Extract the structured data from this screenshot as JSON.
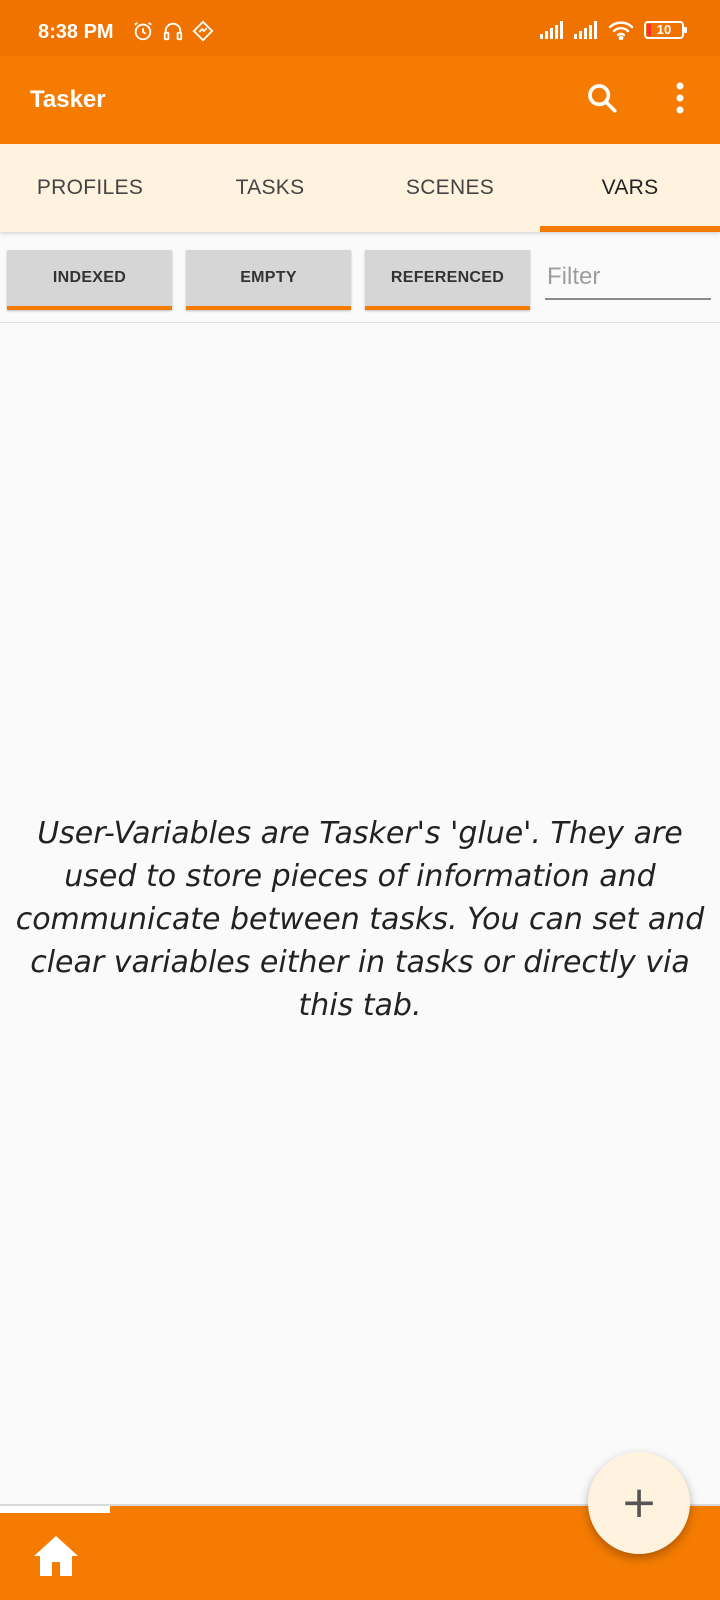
{
  "status_bar": {
    "time": "8:38 PM",
    "battery_level": "10",
    "icons_left": [
      "alarm-icon",
      "headset-icon",
      "sync-icon"
    ],
    "icons_right": [
      "signal-icon",
      "signal-icon",
      "wifi-icon",
      "battery-icon"
    ]
  },
  "app_bar": {
    "title": "Tasker",
    "actions": [
      "search-icon",
      "more-vert-icon"
    ]
  },
  "tabs": [
    {
      "label": "PROFILES",
      "active": false
    },
    {
      "label": "TASKS",
      "active": false
    },
    {
      "label": "SCENES",
      "active": false
    },
    {
      "label": "VARS",
      "active": true
    }
  ],
  "filters": {
    "chips": [
      "INDEXED",
      "EMPTY",
      "REFERENCED"
    ],
    "filter_placeholder": "Filter",
    "filter_value": ""
  },
  "empty_state": {
    "message": "User-Variables are Tasker's 'glue'. They are used to store pieces of information and communicate between tasks. You can set and clear variables either in tasks or directly via this tab."
  },
  "bottom_bar": {
    "home_icon": "home-icon"
  },
  "fab": {
    "label": "+"
  },
  "colors": {
    "status_bar": "#f07300",
    "primary": "#f57c00",
    "tab_background": "#fff3e0",
    "chip_background": "#d6d6d6",
    "page_background": "#fafafa"
  }
}
